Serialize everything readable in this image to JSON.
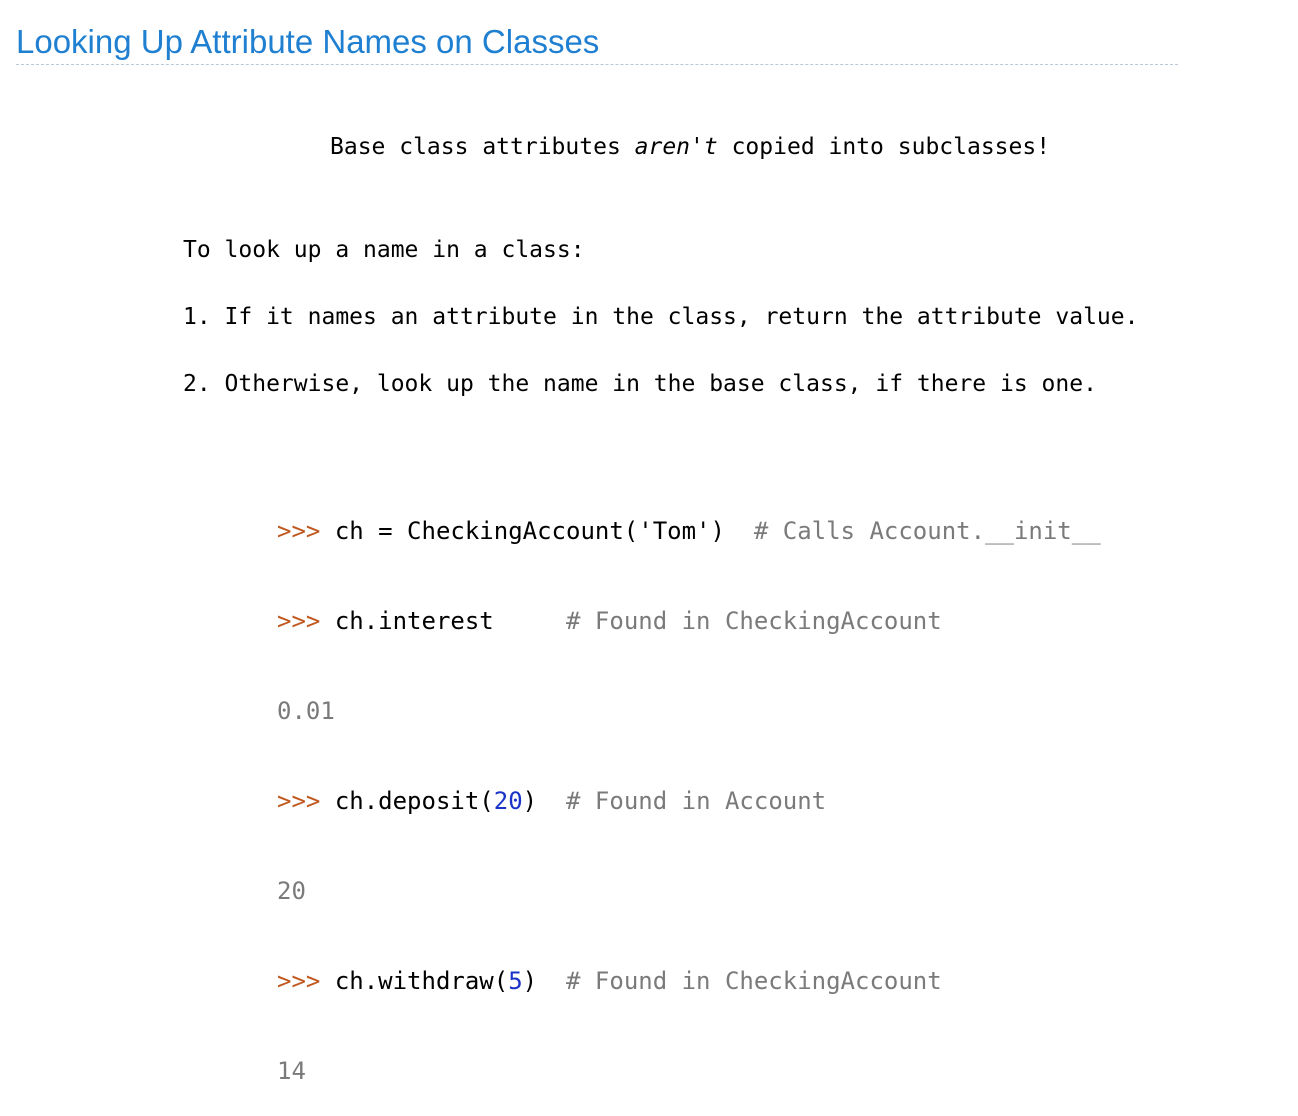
{
  "title": "Looking Up Attribute Names on Classes",
  "note": {
    "before": "Base class attributes ",
    "emphasis": "aren't",
    "after": " copied into subclasses!"
  },
  "lookup": {
    "intro": "To look up a name in a class:",
    "steps": [
      "1. If it names an attribute in the class, return the attribute value.",
      "2. Otherwise, look up the name in the base class, if there is one."
    ]
  },
  "code": {
    "prompt": ">>>",
    "line1": {
      "code": "ch = CheckingAccount('Tom')",
      "comment": "# Calls Account.__init__"
    },
    "line2": {
      "code": "ch.interest",
      "comment": "# Found in CheckingAccount"
    },
    "out2": "0.01",
    "line3": {
      "call_open": "ch.deposit(",
      "arg": "20",
      "call_close": ")",
      "comment": "# Found in Account"
    },
    "out3": "20",
    "line4": {
      "call_open": "ch.withdraw(",
      "arg": "5",
      "call_close": ")",
      "comment": "# Found in CheckingAccount"
    },
    "out4": "14"
  },
  "colors": {
    "title": "#1f7fd0",
    "prompt": "#c0571d",
    "number": "#1a33c8",
    "comment": "#7a7a7a"
  }
}
